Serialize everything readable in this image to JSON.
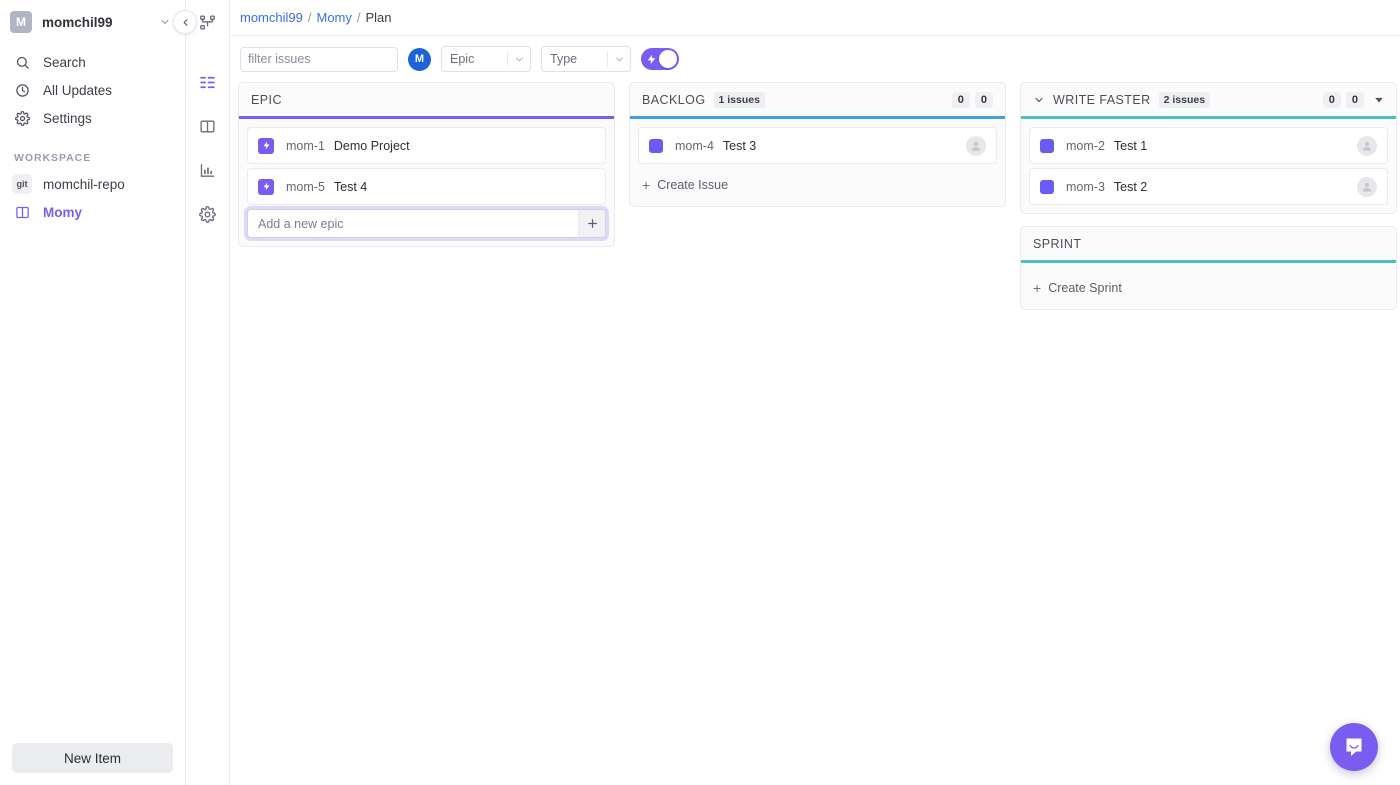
{
  "sidebar": {
    "workspace_user": {
      "initial": "M",
      "name": "momchil99",
      "chevron_icon": "chevron-down-icon"
    },
    "collapse_icon": "chevron-left-icon",
    "nav": [
      {
        "icon": "search-icon",
        "label": "Search"
      },
      {
        "icon": "clock-icon",
        "label": "All Updates"
      },
      {
        "icon": "gear-icon",
        "label": "Settings"
      }
    ],
    "section_title": "WORKSPACE",
    "workspace_items": [
      {
        "badge": "git",
        "label": "momchil-repo",
        "active": false
      },
      {
        "badge": "board-icon",
        "label": "Momy",
        "active": true
      }
    ],
    "new_item_label": "New Item"
  },
  "rail": {
    "items": [
      {
        "icon": "sitemap-icon",
        "active": false
      },
      {
        "icon": "list-grid-icon",
        "active": true
      },
      {
        "icon": "board-columns-icon",
        "active": false
      },
      {
        "icon": "bar-chart-icon",
        "active": false
      },
      {
        "icon": "gear-icon",
        "active": false
      }
    ]
  },
  "breadcrumb": {
    "org": "momchil99",
    "project": "Momy",
    "page": "Plan",
    "separator": "/"
  },
  "toolbar": {
    "search_placeholder": "filter issues",
    "search_value": "",
    "search_icon": "search-icon",
    "user_initial": "M",
    "epic_select": {
      "label": "Epic",
      "arrow_icon": "chevron-down-icon"
    },
    "type_select": {
      "label": "Type",
      "arrow_icon": "chevron-down-icon"
    },
    "toggle": {
      "icon": "lightning-bolt-icon",
      "on": true,
      "color": "#7b5cf0"
    }
  },
  "board": {
    "epic_panel": {
      "title": "EPIC",
      "accent_color": "#7b5cf0",
      "cards": [
        {
          "icon": "lightning-bolt-icon",
          "key": "mom-1",
          "title": "Demo Project"
        },
        {
          "icon": "lightning-bolt-icon",
          "key": "mom-5",
          "title": "Test 4"
        }
      ],
      "add_placeholder": "Add a new epic",
      "add_value": "",
      "add_button_icon": "plus-icon"
    },
    "backlog_panel": {
      "title": "BACKLOG",
      "issue_count_label": "1 issues",
      "accent_color": "#3b9fe0",
      "badge_left": "0",
      "badge_right": "0",
      "cards": [
        {
          "icon": "square-icon",
          "key": "mom-4",
          "title": "Test 3",
          "avatar": "user-avatar-placeholder"
        }
      ],
      "create_label": "Create Issue",
      "create_icon": "plus-icon"
    },
    "write_faster_panel": {
      "title": "WRITE FASTER",
      "issue_count_label": "2 issues",
      "accent_color": "#4cc0bb",
      "collapse_icon": "chevron-down-icon",
      "badge_left": "0",
      "badge_right": "0",
      "menu_icon": "caret-down-icon",
      "cards": [
        {
          "icon": "square-icon",
          "key": "mom-2",
          "title": "Test 1",
          "avatar": "user-avatar-placeholder"
        },
        {
          "icon": "square-icon",
          "key": "mom-3",
          "title": "Test 2",
          "avatar": "user-avatar-placeholder"
        }
      ]
    },
    "sprint_panel": {
      "title": "SPRINT",
      "accent_color": "#4cc0bb",
      "create_label": "Create Sprint",
      "create_icon": "plus-icon"
    }
  },
  "chat": {
    "icon": "chat-bubble-icon",
    "color": "#7b5cf0"
  }
}
